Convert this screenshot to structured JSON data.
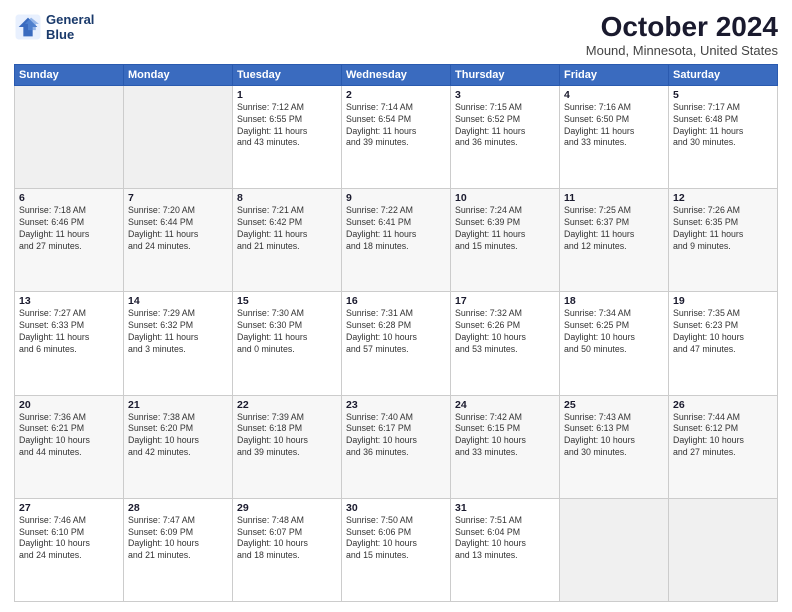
{
  "logo": {
    "line1": "General",
    "line2": "Blue"
  },
  "title": "October 2024",
  "subtitle": "Mound, Minnesota, United States",
  "days_header": [
    "Sunday",
    "Monday",
    "Tuesday",
    "Wednesday",
    "Thursday",
    "Friday",
    "Saturday"
  ],
  "weeks": [
    [
      {
        "day": "",
        "info": ""
      },
      {
        "day": "",
        "info": ""
      },
      {
        "day": "1",
        "info": "Sunrise: 7:12 AM\nSunset: 6:55 PM\nDaylight: 11 hours\nand 43 minutes."
      },
      {
        "day": "2",
        "info": "Sunrise: 7:14 AM\nSunset: 6:54 PM\nDaylight: 11 hours\nand 39 minutes."
      },
      {
        "day": "3",
        "info": "Sunrise: 7:15 AM\nSunset: 6:52 PM\nDaylight: 11 hours\nand 36 minutes."
      },
      {
        "day": "4",
        "info": "Sunrise: 7:16 AM\nSunset: 6:50 PM\nDaylight: 11 hours\nand 33 minutes."
      },
      {
        "day": "5",
        "info": "Sunrise: 7:17 AM\nSunset: 6:48 PM\nDaylight: 11 hours\nand 30 minutes."
      }
    ],
    [
      {
        "day": "6",
        "info": "Sunrise: 7:18 AM\nSunset: 6:46 PM\nDaylight: 11 hours\nand 27 minutes."
      },
      {
        "day": "7",
        "info": "Sunrise: 7:20 AM\nSunset: 6:44 PM\nDaylight: 11 hours\nand 24 minutes."
      },
      {
        "day": "8",
        "info": "Sunrise: 7:21 AM\nSunset: 6:42 PM\nDaylight: 11 hours\nand 21 minutes."
      },
      {
        "day": "9",
        "info": "Sunrise: 7:22 AM\nSunset: 6:41 PM\nDaylight: 11 hours\nand 18 minutes."
      },
      {
        "day": "10",
        "info": "Sunrise: 7:24 AM\nSunset: 6:39 PM\nDaylight: 11 hours\nand 15 minutes."
      },
      {
        "day": "11",
        "info": "Sunrise: 7:25 AM\nSunset: 6:37 PM\nDaylight: 11 hours\nand 12 minutes."
      },
      {
        "day": "12",
        "info": "Sunrise: 7:26 AM\nSunset: 6:35 PM\nDaylight: 11 hours\nand 9 minutes."
      }
    ],
    [
      {
        "day": "13",
        "info": "Sunrise: 7:27 AM\nSunset: 6:33 PM\nDaylight: 11 hours\nand 6 minutes."
      },
      {
        "day": "14",
        "info": "Sunrise: 7:29 AM\nSunset: 6:32 PM\nDaylight: 11 hours\nand 3 minutes."
      },
      {
        "day": "15",
        "info": "Sunrise: 7:30 AM\nSunset: 6:30 PM\nDaylight: 11 hours\nand 0 minutes."
      },
      {
        "day": "16",
        "info": "Sunrise: 7:31 AM\nSunset: 6:28 PM\nDaylight: 10 hours\nand 57 minutes."
      },
      {
        "day": "17",
        "info": "Sunrise: 7:32 AM\nSunset: 6:26 PM\nDaylight: 10 hours\nand 53 minutes."
      },
      {
        "day": "18",
        "info": "Sunrise: 7:34 AM\nSunset: 6:25 PM\nDaylight: 10 hours\nand 50 minutes."
      },
      {
        "day": "19",
        "info": "Sunrise: 7:35 AM\nSunset: 6:23 PM\nDaylight: 10 hours\nand 47 minutes."
      }
    ],
    [
      {
        "day": "20",
        "info": "Sunrise: 7:36 AM\nSunset: 6:21 PM\nDaylight: 10 hours\nand 44 minutes."
      },
      {
        "day": "21",
        "info": "Sunrise: 7:38 AM\nSunset: 6:20 PM\nDaylight: 10 hours\nand 42 minutes."
      },
      {
        "day": "22",
        "info": "Sunrise: 7:39 AM\nSunset: 6:18 PM\nDaylight: 10 hours\nand 39 minutes."
      },
      {
        "day": "23",
        "info": "Sunrise: 7:40 AM\nSunset: 6:17 PM\nDaylight: 10 hours\nand 36 minutes."
      },
      {
        "day": "24",
        "info": "Sunrise: 7:42 AM\nSunset: 6:15 PM\nDaylight: 10 hours\nand 33 minutes."
      },
      {
        "day": "25",
        "info": "Sunrise: 7:43 AM\nSunset: 6:13 PM\nDaylight: 10 hours\nand 30 minutes."
      },
      {
        "day": "26",
        "info": "Sunrise: 7:44 AM\nSunset: 6:12 PM\nDaylight: 10 hours\nand 27 minutes."
      }
    ],
    [
      {
        "day": "27",
        "info": "Sunrise: 7:46 AM\nSunset: 6:10 PM\nDaylight: 10 hours\nand 24 minutes."
      },
      {
        "day": "28",
        "info": "Sunrise: 7:47 AM\nSunset: 6:09 PM\nDaylight: 10 hours\nand 21 minutes."
      },
      {
        "day": "29",
        "info": "Sunrise: 7:48 AM\nSunset: 6:07 PM\nDaylight: 10 hours\nand 18 minutes."
      },
      {
        "day": "30",
        "info": "Sunrise: 7:50 AM\nSunset: 6:06 PM\nDaylight: 10 hours\nand 15 minutes."
      },
      {
        "day": "31",
        "info": "Sunrise: 7:51 AM\nSunset: 6:04 PM\nDaylight: 10 hours\nand 13 minutes."
      },
      {
        "day": "",
        "info": ""
      },
      {
        "day": "",
        "info": ""
      }
    ]
  ]
}
